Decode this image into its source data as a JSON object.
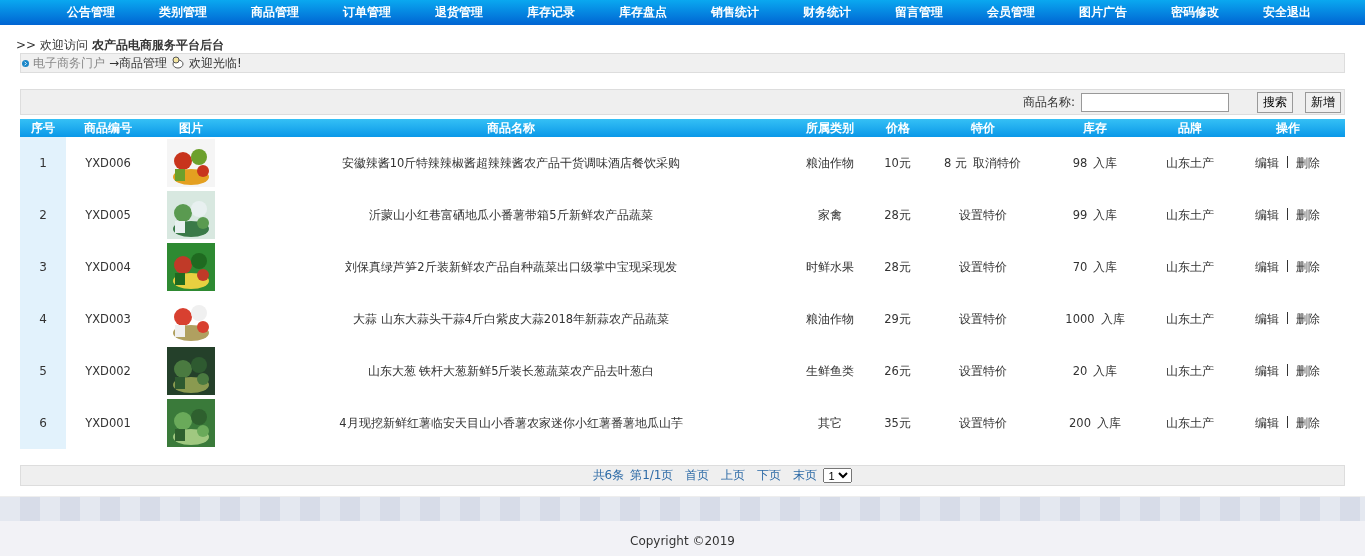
{
  "nav": [
    "公告管理",
    "类别管理",
    "商品管理",
    "订单管理",
    "退货管理",
    "库存记录",
    "库存盘点",
    "销售统计",
    "财务统计",
    "留言管理",
    "会员管理",
    "图片广告",
    "密码修改",
    "安全退出"
  ],
  "welcome": {
    "prefix": ">>",
    "text": "欢迎访问",
    "site": "农产品电商服务平台后台"
  },
  "breadcrumb": {
    "home": "电子商务门户",
    "current": "→商品管理",
    "greeting": "欢迎光临!"
  },
  "search": {
    "label": "商品名称:",
    "buttons": [
      "搜索",
      "新增"
    ]
  },
  "table": {
    "columns": [
      "序号",
      "商品编号",
      "图片",
      "商品名称",
      "所属类别",
      "价格",
      "特价",
      "库存",
      "品牌",
      "操作"
    ],
    "rows": [
      {
        "no": "1",
        "code": "YXD006",
        "name": "安徽辣酱10斤特辣辣椒酱超辣辣酱农产品干货调味酒店餐饮采购",
        "category": "粮油作物",
        "price": "10元",
        "special": {
          "price": "8 元",
          "action": "取消特价"
        },
        "stock": "98",
        "stock_action": "入库",
        "brand": "山东土产",
        "actions": [
          "编辑",
          "删除"
        ]
      },
      {
        "no": "2",
        "code": "YXD005",
        "name": "沂蒙山小红巷富硒地瓜小番薯带箱5斤新鲜农产品蔬菜",
        "category": "家禽",
        "price": "28元",
        "special": {
          "action": "设置特价"
        },
        "stock": "99",
        "stock_action": "入库",
        "brand": "山东土产",
        "actions": [
          "编辑",
          "删除"
        ]
      },
      {
        "no": "3",
        "code": "YXD004",
        "name": "刘保真绿芦笋2斤装新鲜农产品自种蔬菜出口级掌中宝现采现发",
        "category": "时鲜水果",
        "price": "28元",
        "special": {
          "action": "设置特价"
        },
        "stock": "70",
        "stock_action": "入库",
        "brand": "山东土产",
        "actions": [
          "编辑",
          "删除"
        ]
      },
      {
        "no": "4",
        "code": "YXD003",
        "name": "大蒜 山东大蒜头干蒜4斤白紫皮大蒜2018年新蒜农产品蔬菜",
        "category": "粮油作物",
        "price": "29元",
        "special": {
          "action": "设置特价"
        },
        "stock": "1000",
        "stock_action": "入库",
        "brand": "山东土产",
        "actions": [
          "编辑",
          "删除"
        ]
      },
      {
        "no": "5",
        "code": "YXD002",
        "name": "山东大葱 铁杆大葱新鲜5斤装长葱蔬菜农产品去叶葱白",
        "category": "生鲜鱼类",
        "price": "26元",
        "special": {
          "action": "设置特价"
        },
        "stock": "20",
        "stock_action": "入库",
        "brand": "山东土产",
        "actions": [
          "编辑",
          "删除"
        ]
      },
      {
        "no": "6",
        "code": "YXD001",
        "name": "4月现挖新鲜红薯临安天目山小香薯农家迷你小红薯番薯地瓜山芋",
        "category": "其它",
        "price": "35元",
        "special": {
          "action": "设置特价"
        },
        "stock": "200",
        "stock_action": "入库",
        "brand": "山东土产",
        "actions": [
          "编辑",
          "删除"
        ]
      }
    ]
  },
  "pagination": {
    "total": "共6条",
    "page": "第1/1页",
    "links": [
      "首页",
      "上页",
      "下页",
      "末页"
    ],
    "select": "1"
  },
  "footer": "Copyright ©2019"
}
